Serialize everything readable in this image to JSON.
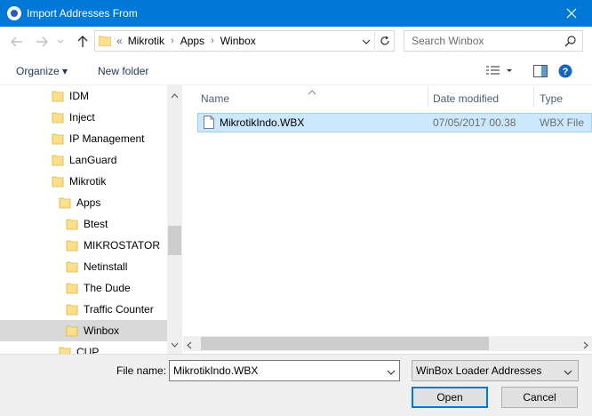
{
  "window": {
    "title": "Import Addresses From"
  },
  "nav": {
    "breadcrumb_overflow": "«",
    "breadcrumb": [
      "Mikrotik",
      "Apps",
      "Winbox"
    ],
    "search_placeholder": "Search Winbox"
  },
  "toolbar": {
    "organize_label": "Organize ▾",
    "new_folder_label": "New folder"
  },
  "tree": {
    "items": [
      {
        "label": "IDM",
        "level": 1
      },
      {
        "label": "Inject",
        "level": 1
      },
      {
        "label": "IP Management",
        "level": 1
      },
      {
        "label": "LanGuard",
        "level": 1
      },
      {
        "label": "Mikrotik",
        "level": 1
      },
      {
        "label": "Apps",
        "level": 2
      },
      {
        "label": "Btest",
        "level": 3
      },
      {
        "label": "MIKROSTATOR",
        "level": 3
      },
      {
        "label": "Netinstall",
        "level": 3
      },
      {
        "label": "The Dude",
        "level": 3
      },
      {
        "label": "Traffic Counter",
        "level": 3
      },
      {
        "label": "Winbox",
        "level": 3,
        "selected": true
      },
      {
        "label": "CUP",
        "level": 2
      }
    ]
  },
  "columns": {
    "name": "Name",
    "date": "Date modified",
    "type": "Type"
  },
  "files": [
    {
      "name": "MikrotikIndo.WBX",
      "date": "07/05/2017 00.38",
      "type": "WBX File"
    }
  ],
  "bottom": {
    "file_name_label": "File name:",
    "file_name_value": "MikrotikIndo.WBX",
    "file_type_value": "WinBox Loader Addresses",
    "open_label": "Open",
    "cancel_label": "Cancel"
  },
  "colors": {
    "accent": "#0078d7",
    "selection": "#cce8ff",
    "folder": "#ffe08a"
  }
}
